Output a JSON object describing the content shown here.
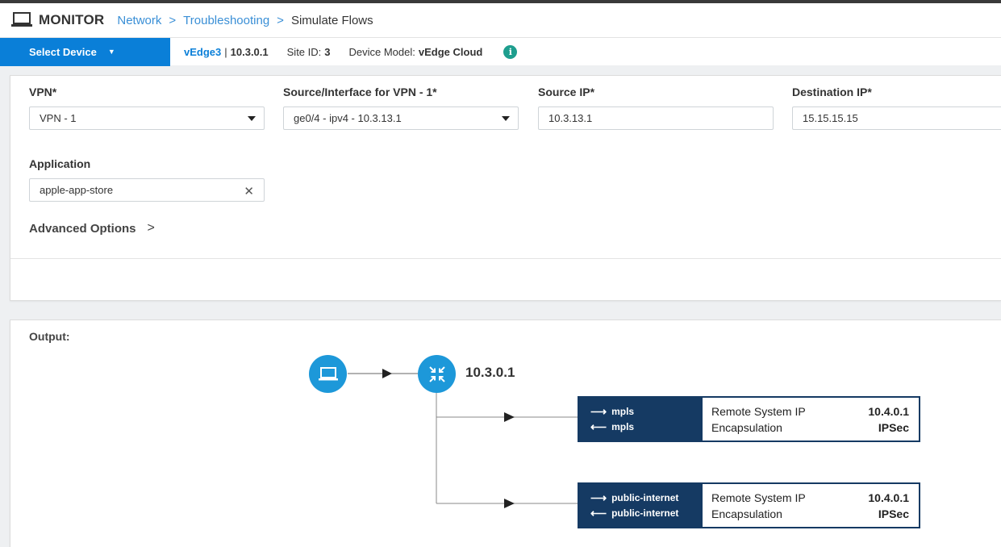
{
  "header": {
    "title": "MONITOR",
    "breadcrumb": [
      "Network",
      "Troubleshooting",
      "Simulate Flows"
    ],
    "separator": ">"
  },
  "device_bar": {
    "select_label": "Select Device",
    "device_name": "vEdge3",
    "device_ip": "10.3.0.1",
    "site_label": "Site ID:",
    "site_value": "3",
    "model_label": "Device Model:",
    "model_value": "vEdge Cloud",
    "info_glyph": "i"
  },
  "form": {
    "vpn": {
      "label": "VPN*",
      "value": "VPN - 1"
    },
    "source_interface": {
      "label": "Source/Interface for VPN - 1*",
      "value": "ge0/4 - ipv4 - 10.3.13.1"
    },
    "source_ip": {
      "label": "Source IP*",
      "value": "10.3.13.1"
    },
    "destination_ip": {
      "label": "Destination IP*",
      "value": "15.15.15.15"
    },
    "application": {
      "label": "Application",
      "value": "apple-app-store"
    },
    "advanced_options": "Advanced Options"
  },
  "output": {
    "label": "Output:",
    "router_ip": "10.3.0.1",
    "tunnels": [
      {
        "outbound": "mpls",
        "inbound": "mpls",
        "remote_label": "Remote System IP",
        "remote_value": "10.4.0.1",
        "encap_label": "Encapsulation",
        "encap_value": "IPSec"
      },
      {
        "outbound": "public-internet",
        "inbound": "public-internet",
        "remote_label": "Remote System IP",
        "remote_value": "10.4.0.1",
        "encap_label": "Encapsulation",
        "encap_value": "IPSec"
      }
    ]
  },
  "colors": {
    "accent": "#0a7fd8",
    "link": "#3a8fd6",
    "node": "#1d98d9",
    "tunnel": "#153a63",
    "info": "#1e9e8e"
  },
  "icons": {
    "monitor": "laptop-icon",
    "host": "laptop-icon",
    "router": "router-icon",
    "info": "info-icon",
    "clear": "close-icon",
    "advanced": "chevron-right-icon"
  }
}
